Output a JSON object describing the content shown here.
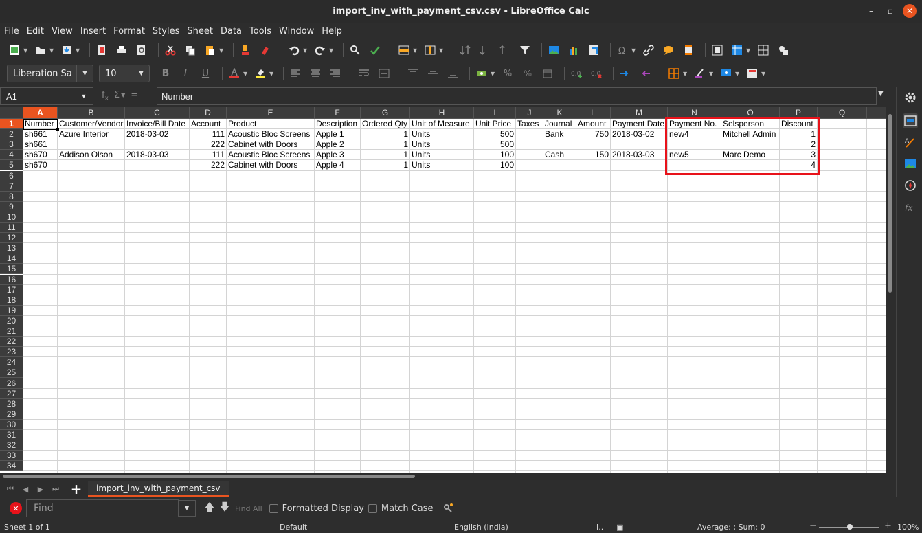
{
  "window": {
    "title": "import_inv_with_payment_csv.csv - LibreOffice Calc",
    "minimize_glyph": "–",
    "restore_glyph": "▫",
    "close_glyph": "✕"
  },
  "menu": [
    "File",
    "Edit",
    "View",
    "Insert",
    "Format",
    "Styles",
    "Sheet",
    "Data",
    "Tools",
    "Window",
    "Help"
  ],
  "format_toolbar": {
    "font_name": "Liberation Sa",
    "font_size": "10",
    "bold": "B",
    "italic": "I",
    "underline": "U"
  },
  "formula_bar": {
    "cell_ref": "A1",
    "content": "Number"
  },
  "columns": [
    {
      "letter": "A"
    },
    {
      "letter": "B"
    },
    {
      "letter": "C"
    },
    {
      "letter": "D"
    },
    {
      "letter": "E"
    },
    {
      "letter": "F"
    },
    {
      "letter": "G"
    },
    {
      "letter": "H"
    },
    {
      "letter": "I"
    },
    {
      "letter": "J"
    },
    {
      "letter": "K"
    },
    {
      "letter": "L"
    },
    {
      "letter": "M"
    },
    {
      "letter": "N"
    },
    {
      "letter": "O"
    },
    {
      "letter": "P"
    },
    {
      "letter": "Q"
    }
  ],
  "row_count": 34,
  "selected_cell": "A1",
  "sheet_rows": [
    [
      "Number",
      "Customer/Vendor",
      "Invoice/Bill Date",
      "Account",
      "Product",
      "Description",
      "Ordered Qty",
      "Unit of Measure",
      "Unit Price",
      "Taxes",
      "Journal",
      "Amount",
      "Payment Date",
      "Payment No.",
      "Selsperson",
      "Discount",
      ""
    ],
    [
      "sh661",
      "Azure Interior",
      "2018-03-02",
      "111",
      "Acoustic Bloc Screens",
      "Apple 1",
      "1",
      "Units",
      "500",
      "",
      "Bank",
      "750",
      "2018-03-02",
      "new4",
      "Mitchell Admin",
      "1",
      ""
    ],
    [
      "sh661",
      "",
      "",
      "222",
      "Cabinet with Doors",
      "Apple 2",
      "1",
      "Units",
      "500",
      "",
      "",
      "",
      "",
      "",
      "",
      "2",
      ""
    ],
    [
      "sh670",
      "Addison Olson",
      "2018-03-03",
      "111",
      "Acoustic Bloc Screens",
      "Apple 3",
      "1",
      "Units",
      "100",
      "",
      "Cash",
      "150",
      "2018-03-03",
      "new5",
      "Marc Demo",
      "3",
      ""
    ],
    [
      "sh670",
      "",
      "",
      "222",
      "Cabinet with Doors",
      "Apple 4",
      "1",
      "Units",
      "100",
      "",
      "",
      "",
      "",
      "",
      "",
      "4",
      ""
    ]
  ],
  "sheet_tab": "import_inv_with_payment_csv",
  "find_bar": {
    "placeholder": "Find",
    "find_all": "Find All",
    "formatted_display": "Formatted Display",
    "match_case": "Match Case"
  },
  "status": {
    "sheet": "Sheet 1 of 1",
    "page_style": "Default",
    "language": "English (India)",
    "sum": "Average: ; Sum: 0",
    "zoom": "100%",
    "zoom_minus": "−",
    "zoom_plus": "+"
  },
  "colors": {
    "accent": "#e95420",
    "highlight_box": "#e8121a"
  }
}
